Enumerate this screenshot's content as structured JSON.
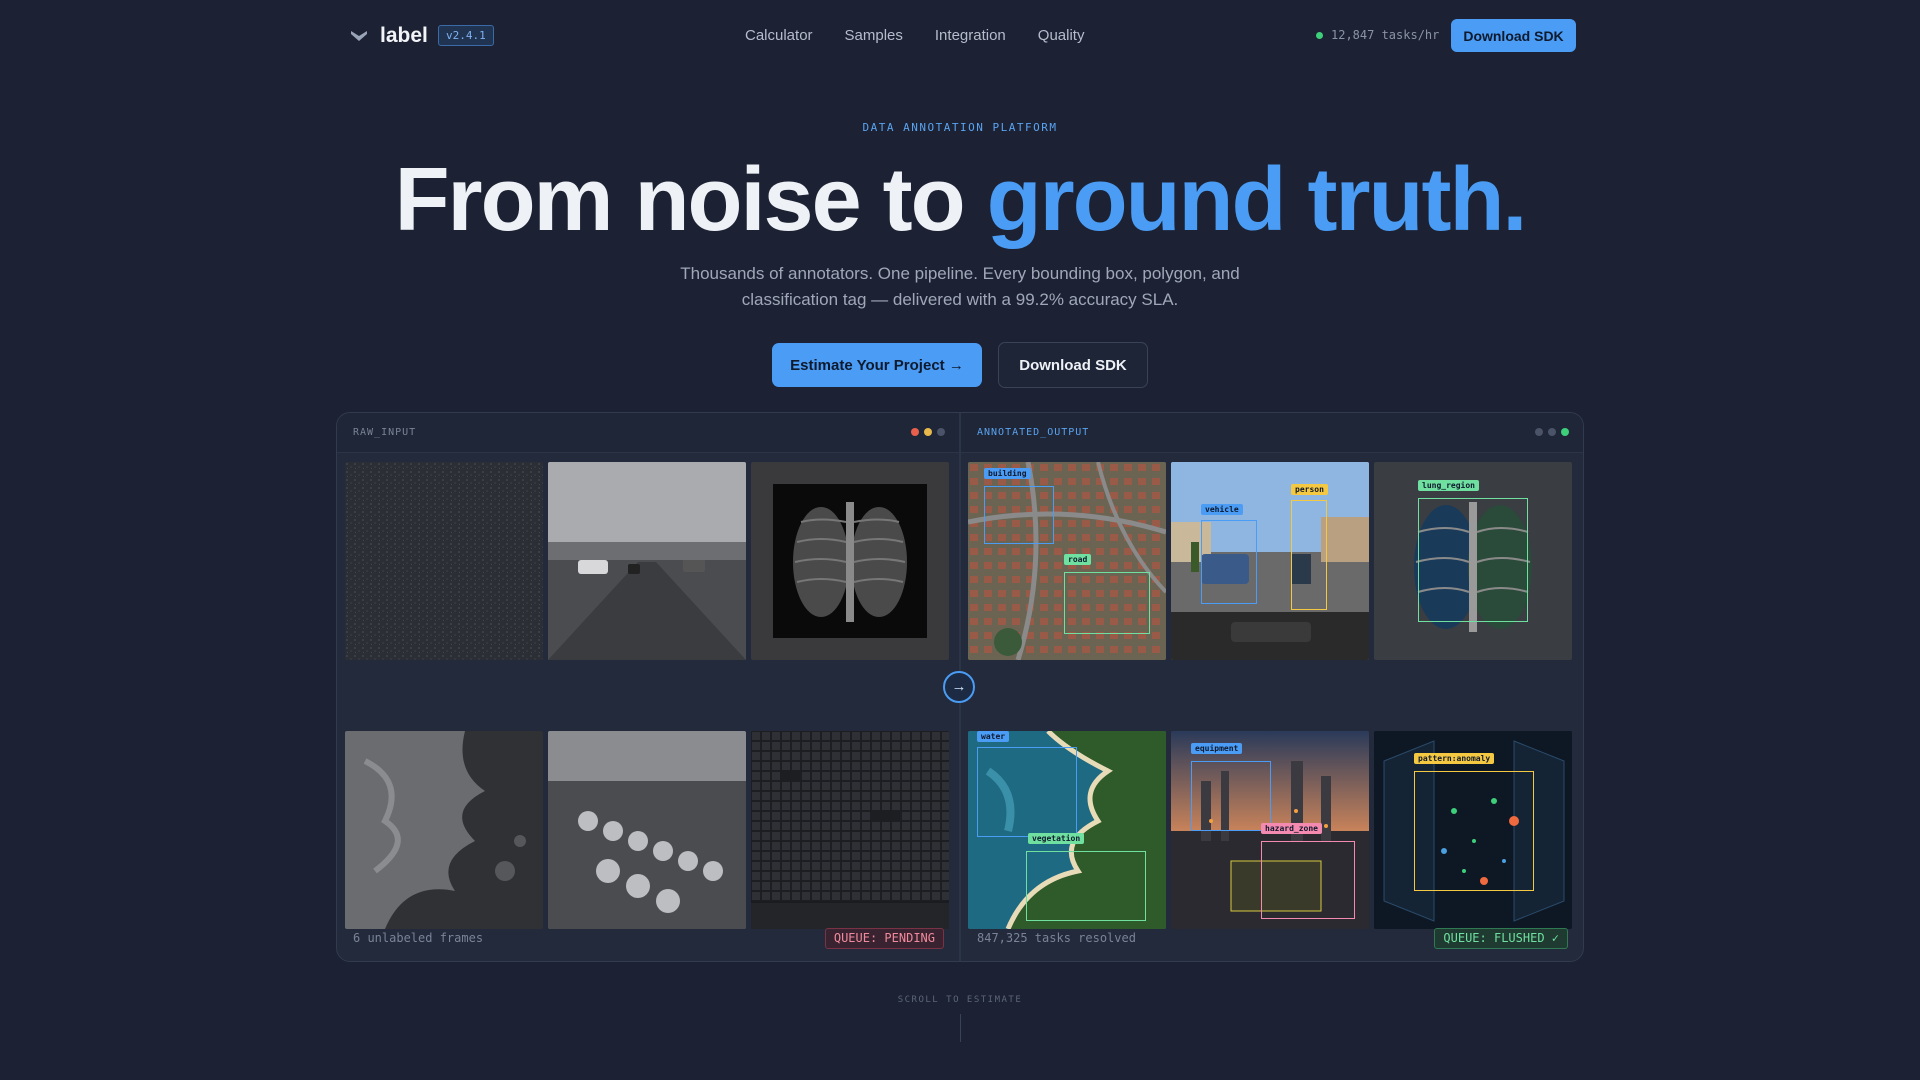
{
  "nav": {
    "brand": "label",
    "version": "v2.4.1",
    "links": [
      "Calculator",
      "Samples",
      "Integration",
      "Quality"
    ],
    "rate": "12,847 tasks/hr",
    "cta": "Download SDK"
  },
  "hero": {
    "eyebrow": "DATA ANNOTATION PLATFORM",
    "headline_plain": "From noise to ",
    "headline_accent": "ground truth.",
    "subtitle": "Thousands of annotators. One pipeline. Every bounding box, polygon, and classification tag — delivered with a 99.2% accuracy SLA.",
    "cta_primary": "Estimate Your Project →",
    "cta_secondary": "Download SDK"
  },
  "raw_panel": {
    "title": "RAW_INPUT",
    "footer": "6 unlabeled frames",
    "badge": "QUEUE: PENDING"
  },
  "annotated_panel": {
    "title": "ANNOTATED_OUTPUT",
    "footer": "847,325 tasks resolved",
    "badge": "QUEUE: FLUSHED ✓",
    "labels": {
      "building": "building",
      "road": "road",
      "vehicle": "vehicle",
      "person": "person",
      "lung_region": "lung_region",
      "water": "water",
      "vegetation": "vegetation",
      "equipment": "equipment",
      "hazard_zone": "hazard_zone",
      "pattern_anomaly": "pattern:anomaly"
    }
  },
  "scroll_hint": "SCROLL TO ESTIMATE",
  "colors": {
    "accent": "#4a9cf5",
    "success": "#3ecf7a",
    "danger": "#f08a9c",
    "tag_blue": "#4a9cf5",
    "tag_yellow": "#f5c842",
    "tag_green": "#6fe0a0",
    "tag_pink": "#f58ab0"
  },
  "icons": {
    "logo": "label-logo-icon",
    "arrow": "arrow-right-icon"
  }
}
